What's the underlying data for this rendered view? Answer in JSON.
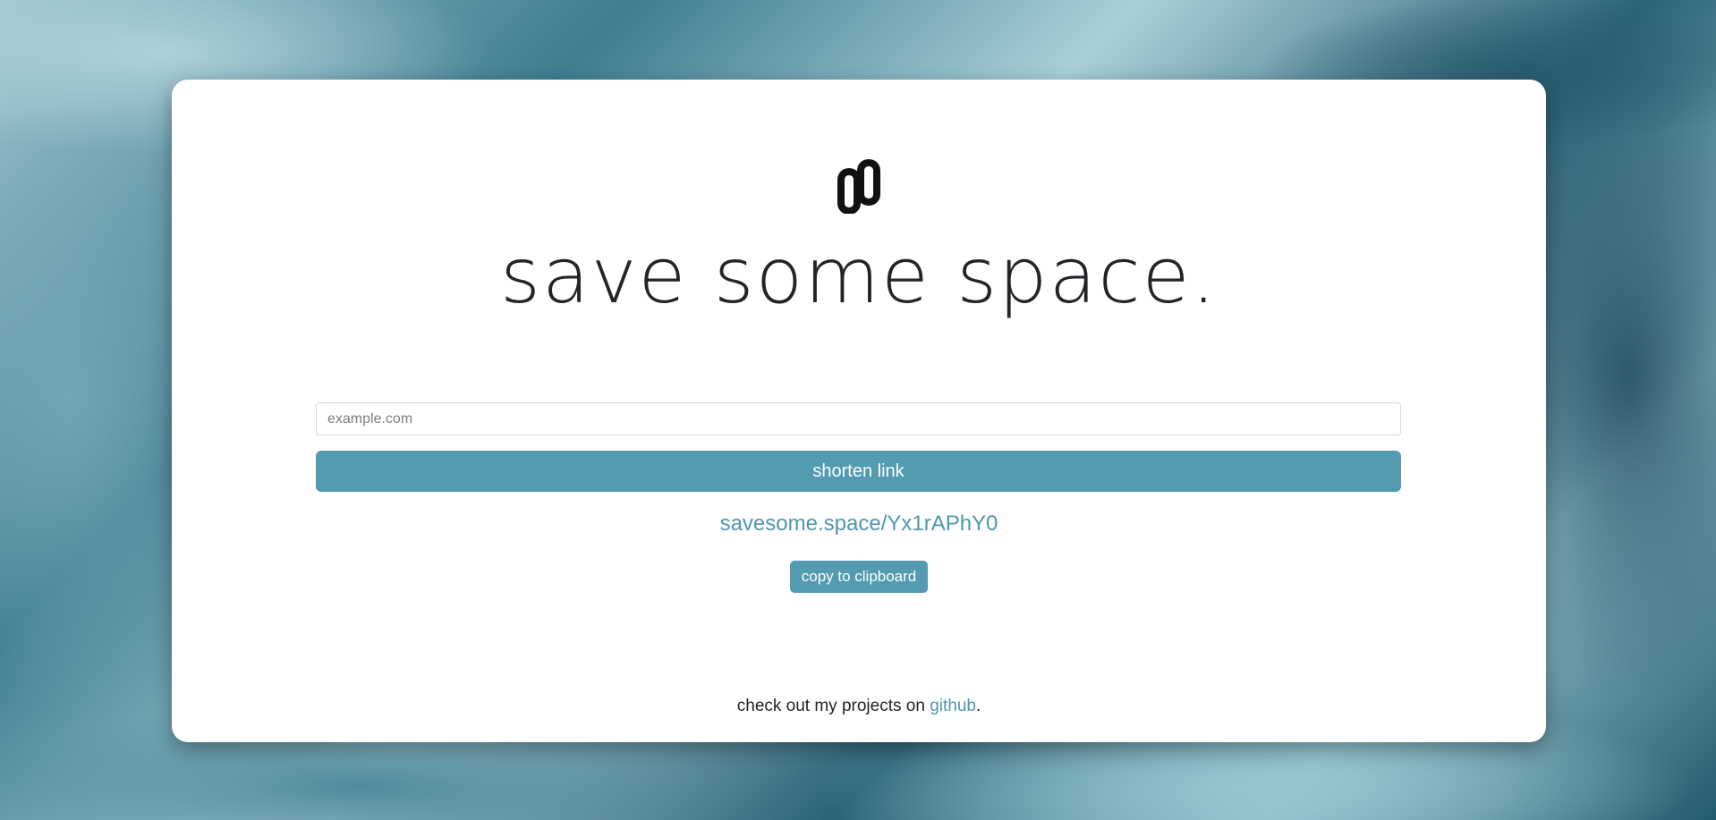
{
  "brand": {
    "logo_icon": "link-chain-icon",
    "headline": "save some space."
  },
  "form": {
    "url_placeholder": "example.com",
    "url_value": "",
    "shorten_label": "shorten link"
  },
  "result": {
    "short_url": "savesome.space/Yx1rAPhY0",
    "copy_label": "copy to clipboard"
  },
  "footer": {
    "prefix": "check out my projects on ",
    "link_text": "github",
    "suffix": "."
  },
  "colors": {
    "accent": "#529bb1",
    "link": "#4f97ad",
    "text": "#222428",
    "card_bg": "#ffffff"
  }
}
